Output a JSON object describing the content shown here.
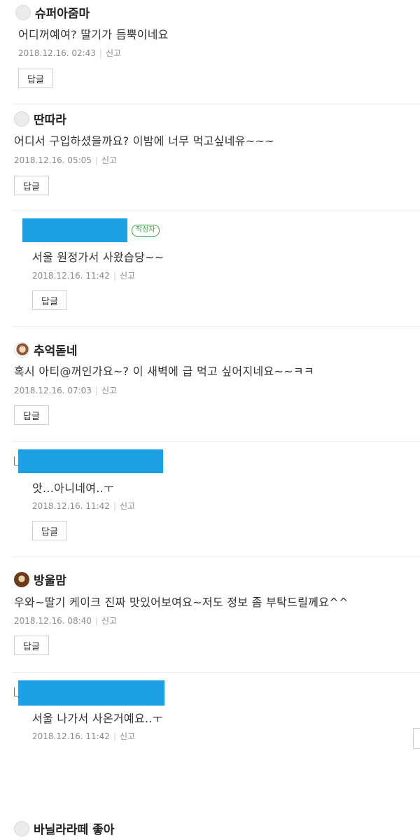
{
  "comments": [
    {
      "nickname": "슈퍼아줌마",
      "text": "어디꺼예여? 딸기가 듬뿍이네요",
      "date": "2018.12.16. 02:43",
      "report": "신고",
      "reply": "답글",
      "avatar": "default-avatar"
    },
    {
      "nickname": "딴따라",
      "text": "어디서 구입하셨을까요? 이밤에 너무 먹고싶네유~~~",
      "date": "2018.12.16. 05:05",
      "report": "신고",
      "reply": "답글",
      "avatar": "default-avatar"
    },
    {
      "is_reply": true,
      "author_badge": "작성자",
      "text": "서울 원정가서 사왔습당~~",
      "date": "2018.12.16. 11:42",
      "report": "신고",
      "reply": "답글",
      "redacted_color": "#1d9fe3"
    },
    {
      "nickname": "추억돋네",
      "text": "혹시 아티@꺼인가요~? 이 새벽에 급 먹고 싶어지네요~~ㅋㅋ",
      "date": "2018.12.16. 07:03",
      "report": "신고",
      "reply": "답글",
      "avatar": "photo-avatar"
    },
    {
      "is_reply": true,
      "text": "앗...아니네여..ㅜ",
      "date": "2018.12.16. 11:42",
      "report": "신고",
      "reply": "답글",
      "redacted_color": "#1d9fe3"
    },
    {
      "nickname": "방울맘",
      "text": "우와~딸기 케이크 진짜 맛있어보여요~저도 정보 좀 부탁드릴께요^^",
      "date": "2018.12.16. 08:40",
      "report": "신고",
      "reply": "답글",
      "avatar": "photo-avatar"
    },
    {
      "is_reply": true,
      "text": "서울 나가서 사온거예요..ㅜ",
      "date": "2018.12.16. 11:42",
      "report": "신고",
      "redacted_color": "#1d9fe3"
    },
    {
      "nickname": "바닐라라떼 좋아",
      "avatar": "default-avatar"
    }
  ]
}
